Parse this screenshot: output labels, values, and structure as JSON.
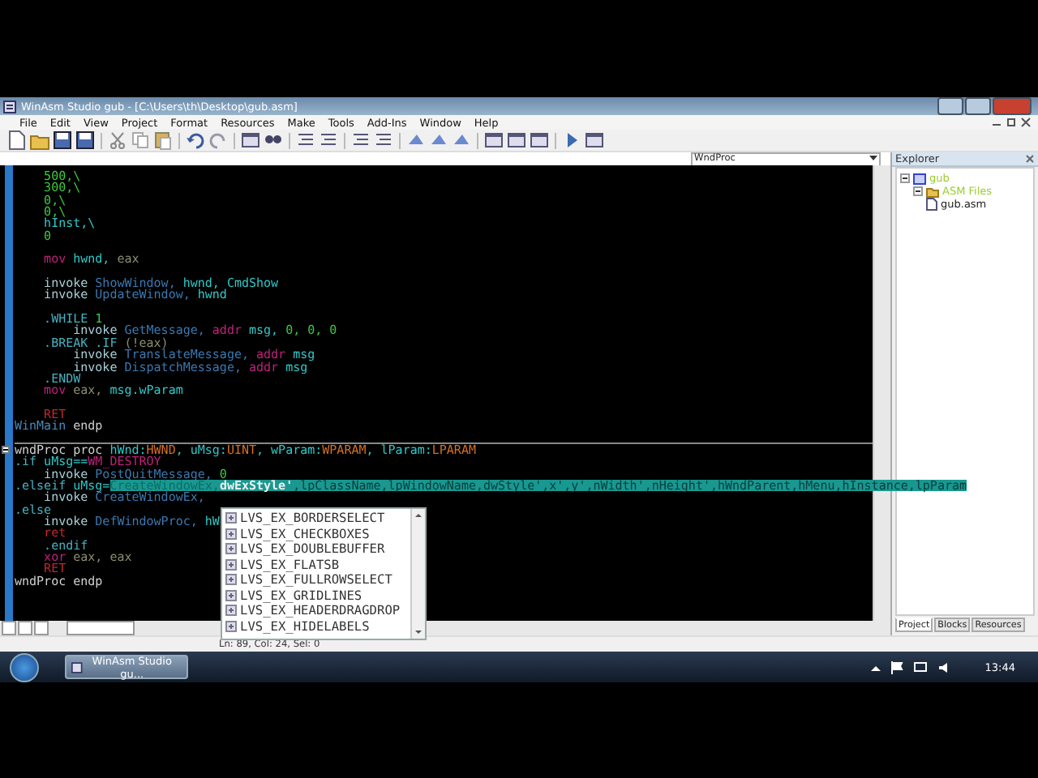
{
  "window": {
    "title": "WinAsm Studio gub - [C:\\Users\\th\\Desktop\\gub.asm]"
  },
  "menu": [
    "File",
    "Edit",
    "View",
    "Project",
    "Format",
    "Resources",
    "Make",
    "Tools",
    "Add-Ins",
    "Window",
    "Help"
  ],
  "procedure_combo": {
    "value": "WndProc"
  },
  "editor": {
    "lines": [
      {
        "kind": "code",
        "tokens": [
          {
            "text": "    500,\\",
            "color": "#3cc83c"
          }
        ]
      },
      {
        "kind": "code",
        "tokens": [
          {
            "text": "    300,\\",
            "color": "#3cc83c"
          }
        ]
      },
      {
        "kind": "code",
        "tokens": [
          {
            "text": "    0,\\",
            "color": "#3cc83c"
          }
        ]
      },
      {
        "kind": "code",
        "tokens": [
          {
            "text": "    0,\\",
            "color": "#3cc83c"
          }
        ]
      },
      {
        "kind": "code",
        "tokens": [
          {
            "text": "    hInst,\\",
            "color": "#30c8c8"
          }
        ]
      },
      {
        "kind": "code",
        "tokens": [
          {
            "text": "    0",
            "color": "#3cc83c"
          }
        ]
      },
      {
        "kind": "blank"
      },
      {
        "kind": "code",
        "tokens": [
          {
            "text": "    mov",
            "color": "#c0207a"
          },
          {
            "text": " hwnd,",
            "color": "#30c8c8"
          },
          {
            "text": " eax",
            "color": "#8c8c70"
          }
        ]
      },
      {
        "kind": "blank"
      },
      {
        "kind": "code",
        "tokens": [
          {
            "text": "    invoke",
            "color": "#a8d0d8"
          },
          {
            "text": " ShowWindow,",
            "color": "#3a78b0"
          },
          {
            "text": " hwnd, CmdShow",
            "color": "#30c8c8"
          }
        ]
      },
      {
        "kind": "code",
        "tokens": [
          {
            "text": "    invoke",
            "color": "#a8d0d8"
          },
          {
            "text": " UpdateWindow,",
            "color": "#3a78b0"
          },
          {
            "text": " hwnd",
            "color": "#30c8c8"
          }
        ]
      },
      {
        "kind": "blank"
      },
      {
        "kind": "code",
        "tokens": [
          {
            "text": "    .WHILE",
            "color": "#48b0c0"
          },
          {
            "text": " 1",
            "color": "#3cc83c"
          }
        ]
      },
      {
        "kind": "code",
        "tokens": [
          {
            "text": "        invoke",
            "color": "#a8d0d8"
          },
          {
            "text": " GetMessage,",
            "color": "#3a78b0"
          },
          {
            "text": " addr",
            "color": "#c0207a"
          },
          {
            "text": " msg,",
            "color": "#30c8c8"
          },
          {
            "text": " 0, 0, 0",
            "color": "#3cc83c"
          }
        ]
      },
      {
        "kind": "code",
        "tokens": [
          {
            "text": "    .BREAK .IF",
            "color": "#48b0c0"
          },
          {
            "text": " (!eax)",
            "color": "#8c8c70"
          }
        ]
      },
      {
        "kind": "code",
        "tokens": [
          {
            "text": "        invoke",
            "color": "#a8d0d8"
          },
          {
            "text": " TranslateMessage,",
            "color": "#3a78b0"
          },
          {
            "text": " addr",
            "color": "#c0207a"
          },
          {
            "text": " msg",
            "color": "#30c8c8"
          }
        ]
      },
      {
        "kind": "code",
        "tokens": [
          {
            "text": "        invoke",
            "color": "#a8d0d8"
          },
          {
            "text": " DispatchMessage,",
            "color": "#3a78b0"
          },
          {
            "text": " addr",
            "color": "#c0207a"
          },
          {
            "text": " msg",
            "color": "#30c8c8"
          }
        ]
      },
      {
        "kind": "code",
        "tokens": [
          {
            "text": "    .ENDW",
            "color": "#48b0c0"
          }
        ]
      },
      {
        "kind": "code",
        "tokens": [
          {
            "text": "    mov",
            "color": "#c0207a"
          },
          {
            "text": " eax,",
            "color": "#8c8c70"
          },
          {
            "text": " msg.wParam",
            "color": "#30c8c8"
          }
        ]
      },
      {
        "kind": "blank"
      },
      {
        "kind": "code",
        "tokens": [
          {
            "text": "    RET",
            "color": "#c02828"
          }
        ]
      },
      {
        "kind": "code",
        "tokens": [
          {
            "text": "WinMain",
            "color": "#4a88b8"
          },
          {
            "text": " endp",
            "color": "#d0d0d0"
          }
        ]
      },
      {
        "kind": "blank"
      },
      {
        "kind": "proc",
        "tokens": [
          {
            "text": "wndProc proc",
            "color": "#d0d0d0"
          },
          {
            "text": " hWnd:",
            "color": "#30c8c8"
          },
          {
            "text": "HWND",
            "color": "#d87020"
          },
          {
            "text": ", uMsg:",
            "color": "#30c8c8"
          },
          {
            "text": "UINT",
            "color": "#d87020"
          },
          {
            "text": ", wParam:",
            "color": "#30c8c8"
          },
          {
            "text": "WPARAM",
            "color": "#d87020"
          },
          {
            "text": ", lParam:",
            "color": "#30c8c8"
          },
          {
            "text": "LPARAM",
            "color": "#d87020"
          }
        ]
      },
      {
        "kind": "code",
        "tokens": [
          {
            "text": ".if",
            "color": "#48b0c0"
          },
          {
            "text": " uMsg==",
            "color": "#30c8c8"
          },
          {
            "text": "WM_DESTROY",
            "color": "#c0207a"
          }
        ]
      },
      {
        "kind": "code",
        "tokens": [
          {
            "text": "    invoke",
            "color": "#a8d0d8"
          },
          {
            "text": " PostQuitMessage,",
            "color": "#3a78b0"
          },
          {
            "text": " 0",
            "color": "#3cc83c"
          }
        ]
      },
      {
        "kind": "tooltip",
        "tokens": [
          {
            "text": ".elseif",
            "color": "#48b0c0"
          },
          {
            "text": " uMsg=",
            "color": "#30c8c8"
          }
        ],
        "tooltip": {
          "before": "CreateWindowEx,",
          "current": "dwExStyle'",
          "after": ",lpClassName,lpWindowName,dwStyle',x',y',nWidth',nHeight',hWndParent,hMenu,hInstance,lpParam"
        }
      },
      {
        "kind": "code",
        "tokens": [
          {
            "text": "    invoke",
            "color": "#a8d0d8"
          },
          {
            "text": " CreateWindowEx,",
            "color": "#3a78b0"
          }
        ]
      },
      {
        "kind": "code",
        "tokens": [
          {
            "text": ".else",
            "color": "#48b0c0"
          }
        ]
      },
      {
        "kind": "code",
        "tokens": [
          {
            "text": "    invoke",
            "color": "#a8d0d8"
          },
          {
            "text": " DefWindowProc,",
            "color": "#3a78b0"
          },
          {
            "text": " hW",
            "color": "#30c8c8"
          }
        ]
      },
      {
        "kind": "code",
        "tokens": [
          {
            "text": "    ret",
            "color": "#c02828"
          }
        ]
      },
      {
        "kind": "code",
        "tokens": [
          {
            "text": "    .endif",
            "color": "#48b0c0"
          }
        ]
      },
      {
        "kind": "code",
        "tokens": [
          {
            "text": "    xor",
            "color": "#c0207a"
          },
          {
            "text": " eax, eax",
            "color": "#8c8c70"
          }
        ]
      },
      {
        "kind": "code",
        "tokens": [
          {
            "text": "    RET",
            "color": "#c02828"
          }
        ]
      },
      {
        "kind": "code",
        "tokens": [
          {
            "text": "wndProc endp",
            "color": "#d0d0d0"
          }
        ]
      }
    ]
  },
  "autocomplete": {
    "items": [
      "LVS_EX_BORDERSELECT",
      "LVS_EX_CHECKBOXES",
      "LVS_EX_DOUBLEBUFFER",
      "LVS_EX_FLATSB",
      "LVS_EX_FULLROWSELECT",
      "LVS_EX_GRIDLINES",
      "LVS_EX_HEADERDRAGDROP",
      "LVS_EX_HIDELABELS"
    ]
  },
  "explorer": {
    "title": "Explorer",
    "tree": [
      {
        "label": "gub",
        "expanded": true,
        "children": [
          {
            "label": "ASM Files",
            "expanded": true,
            "children": [
              {
                "label": "gub.asm"
              }
            ]
          }
        ]
      }
    ],
    "tabs": [
      {
        "label": "Project",
        "selected": true
      },
      {
        "label": "Blocks",
        "selected": false
      },
      {
        "label": "Resources",
        "selected": false
      }
    ]
  },
  "status_bar": {
    "position": "Ln: 89, Col: 24, Sel: 0"
  },
  "taskbar": {
    "task": "WinAsm Studio gu...",
    "clock": "13:44"
  }
}
